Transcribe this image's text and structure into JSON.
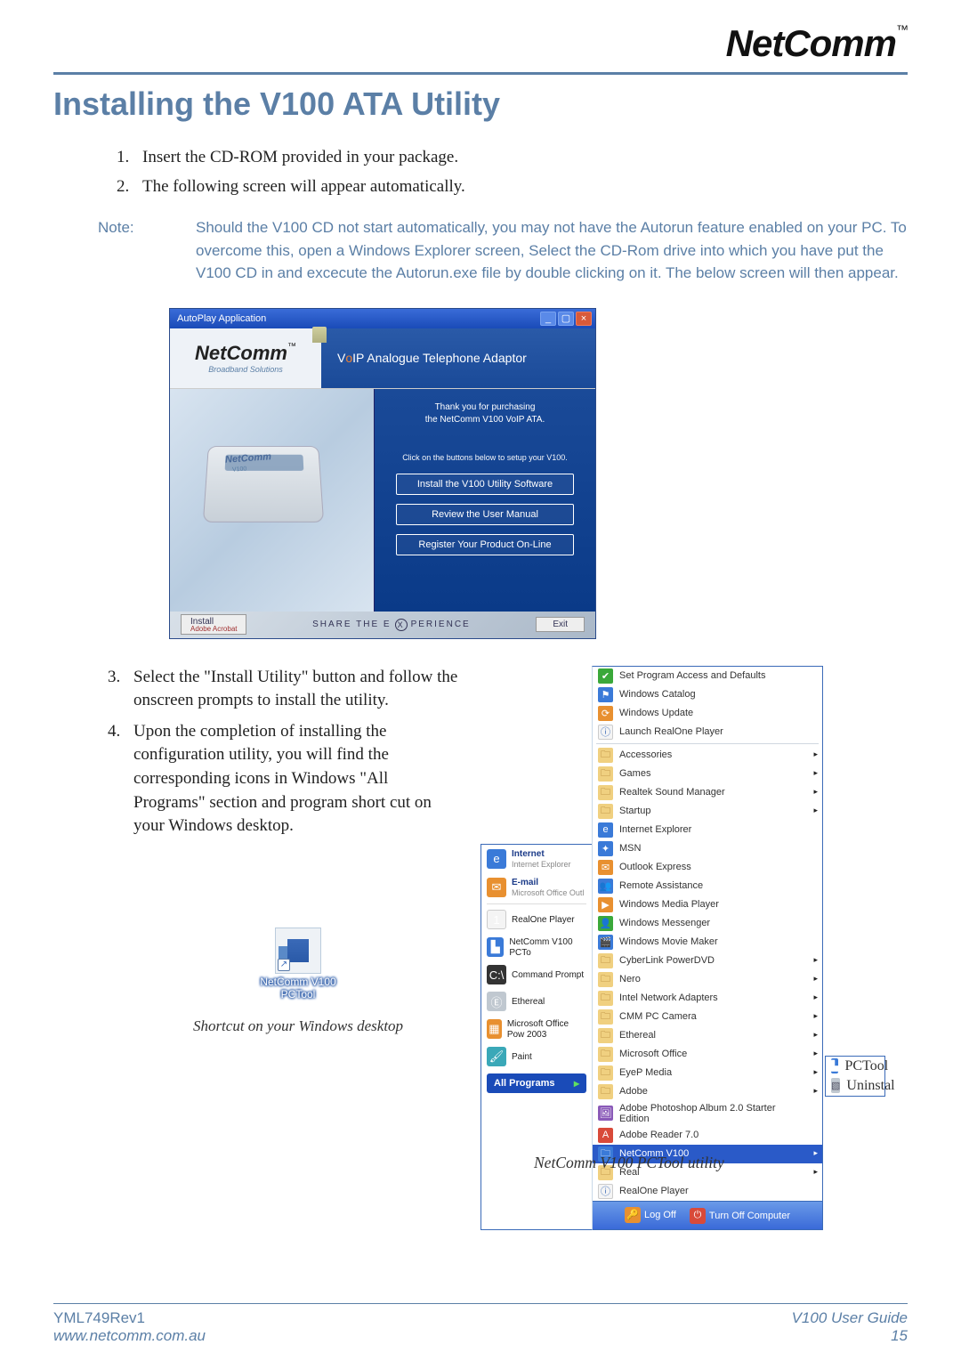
{
  "brand": {
    "name": "NetComm",
    "tm": "™"
  },
  "title": "Installing the V100 ATA Utility",
  "steps_a": [
    "Insert the CD-ROM provided in your package.",
    "The following screen will appear automatically."
  ],
  "note": {
    "label": "Note:",
    "text": "Should the V100 CD not start automatically, you may not have the Autorun feature enabled on your PC. To overcome this, open a Windows Explorer screen, Select the CD-Rom drive into which you have put the V100 CD in and excecute the Autorun.exe file by double clicking on it. The below screen will then appear."
  },
  "autoplay": {
    "titlebar": "AutoPlay Application",
    "logo": "NetComm",
    "logo_tm": "™",
    "logo_sub": "Broadband Solutions",
    "banner_prefix": "V",
    "banner_o": "o",
    "banner_rest": "IP Analogue Telephone Adaptor",
    "device_brand": "NetComm",
    "device_model": "V100",
    "thanks_l1": "Thank you for purchasing",
    "thanks_l2": "the NetComm V100 VoIP ATA.",
    "hint": "Click on the buttons below to setup your V100.",
    "btn_install": "Install the V100 Utility Software",
    "btn_manual": "Review the User Manual",
    "btn_register": "Register Your Product On-Line",
    "footer_install": "Install",
    "footer_install_sub": "Adobe Acrobat",
    "footer_share_pre": "SHARE THE E",
    "footer_share_x": "X",
    "footer_share_post": "PERIENCE",
    "footer_exit": "Exit"
  },
  "steps_b": [
    "Select the \"Install Utility\" button and follow the onscreen prompts to install the utility.",
    " Upon the completion of installing the configuration utility, you will find the corresponding icons in Windows \"All Programs\" section and program short cut on your Windows desktop."
  ],
  "shortcut": {
    "label_l1": "NetComm V100",
    "label_l2": "PCTool",
    "caption": "Shortcut on your Windows desktop"
  },
  "startmenu": {
    "pinned": [
      {
        "title": "Internet",
        "sub": "Internet Explorer",
        "ic": "ic-blue",
        "glyph": "e"
      },
      {
        "title": "E-mail",
        "sub": "Microsoft Office Outl",
        "ic": "ic-orange",
        "glyph": "✉"
      }
    ],
    "recent": [
      {
        "label": "RealOne Player",
        "ic": "ic-white",
        "glyph": "1"
      },
      {
        "label": "NetComm V100 PCTo",
        "ic": "ic-blue",
        "glyph": "▙"
      },
      {
        "label": "Command Prompt",
        "ic": "ic-dark",
        "glyph": "C:\\"
      },
      {
        "label": "Ethereal",
        "ic": "ic-grey",
        "glyph": "Ⓔ"
      },
      {
        "label": "Microsoft Office Pow 2003",
        "ic": "ic-orange",
        "glyph": "▦"
      },
      {
        "label": "Paint",
        "ic": "ic-teal",
        "glyph": "🖌"
      }
    ],
    "all_programs": "All Programs",
    "top_items": [
      {
        "label": "Set Program Access and Defaults",
        "ic": "ic-green",
        "glyph": "✔"
      },
      {
        "label": "Windows Catalog",
        "ic": "ic-blue",
        "glyph": "⚑"
      },
      {
        "label": "Windows Update",
        "ic": "ic-orange",
        "glyph": "⟳"
      },
      {
        "label": "Launch RealOne Player",
        "ic": "ic-white",
        "glyph": "ⓘ"
      }
    ],
    "groups": [
      {
        "label": "Accessories",
        "ic": "ic-folder",
        "glyph": "🗀",
        "arrow": true
      },
      {
        "label": "Games",
        "ic": "ic-folder",
        "glyph": "🗀",
        "arrow": true
      },
      {
        "label": "Realtek Sound Manager",
        "ic": "ic-folder",
        "glyph": "🗀",
        "arrow": true
      },
      {
        "label": "Startup",
        "ic": "ic-folder",
        "glyph": "🗀",
        "arrow": true
      },
      {
        "label": "Internet Explorer",
        "ic": "ic-blue",
        "glyph": "e"
      },
      {
        "label": "MSN",
        "ic": "ic-blue",
        "glyph": "✦"
      },
      {
        "label": "Outlook Express",
        "ic": "ic-orange",
        "glyph": "✉"
      },
      {
        "label": "Remote Assistance",
        "ic": "ic-blue",
        "glyph": "👥"
      },
      {
        "label": "Windows Media Player",
        "ic": "ic-orange",
        "glyph": "▶"
      },
      {
        "label": "Windows Messenger",
        "ic": "ic-green",
        "glyph": "👤"
      },
      {
        "label": "Windows Movie Maker",
        "ic": "ic-blue",
        "glyph": "🎬"
      },
      {
        "label": "CyberLink PowerDVD",
        "ic": "ic-folder",
        "glyph": "🗀",
        "arrow": true
      },
      {
        "label": "Nero",
        "ic": "ic-folder",
        "glyph": "🗀",
        "arrow": true
      },
      {
        "label": "Intel Network Adapters",
        "ic": "ic-folder",
        "glyph": "🗀",
        "arrow": true
      },
      {
        "label": "CMM PC Camera",
        "ic": "ic-folder",
        "glyph": "🗀",
        "arrow": true
      },
      {
        "label": "Ethereal",
        "ic": "ic-folder",
        "glyph": "🗀",
        "arrow": true
      },
      {
        "label": "Microsoft Office",
        "ic": "ic-folder",
        "glyph": "🗀",
        "arrow": true
      },
      {
        "label": "EyeP Media",
        "ic": "ic-folder",
        "glyph": "🗀",
        "arrow": true
      },
      {
        "label": "Adobe",
        "ic": "ic-folder",
        "glyph": "🗀",
        "arrow": true
      },
      {
        "label": "Adobe Photoshop Album 2.0 Starter Edition",
        "ic": "ic-purple",
        "glyph": "🖼"
      },
      {
        "label": "Adobe Reader 7.0",
        "ic": "ic-red",
        "glyph": "A"
      }
    ],
    "highlight": {
      "label": "NetComm V100",
      "ic": "ic-blue",
      "glyph": "🗀",
      "arrow": true
    },
    "tail": [
      {
        "label": "Real",
        "ic": "ic-folder",
        "glyph": "🗀",
        "arrow": true
      },
      {
        "label": "RealOne Player",
        "ic": "ic-white",
        "glyph": "ⓘ"
      }
    ],
    "flyout": [
      {
        "label": "PCTool",
        "ic": "ic-blue",
        "glyph": "▙"
      },
      {
        "label": "Uninstal",
        "ic": "ic-grey",
        "glyph": "▧"
      }
    ],
    "logoff": "Log Off",
    "turnoff": "Turn Off Computer",
    "caption": "NetComm V100 PCTool utility"
  },
  "footer": {
    "left_l1": "YML749Rev1",
    "left_l2": "www.netcomm.com.au",
    "right_l1": "V100 User Guide",
    "right_l2": "15"
  }
}
